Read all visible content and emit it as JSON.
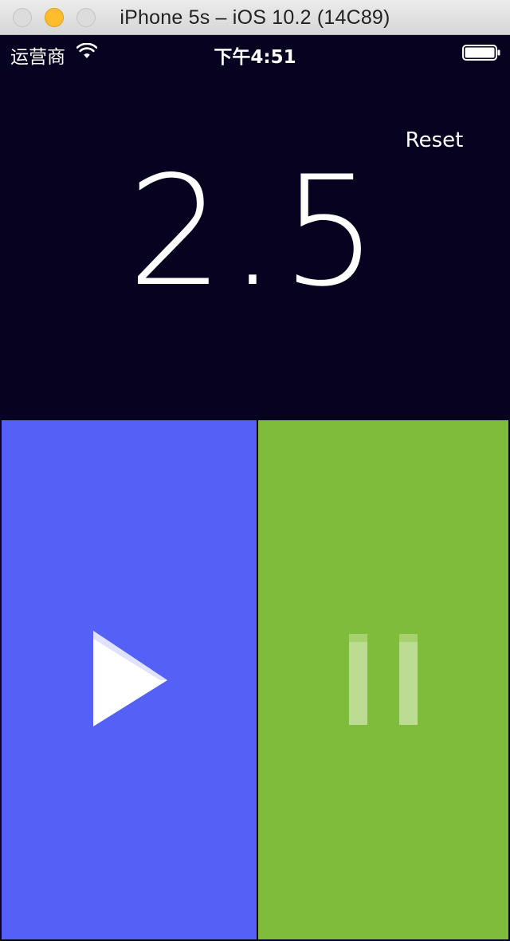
{
  "window": {
    "title": "iPhone 5s – iOS 10.2 (14C89)"
  },
  "status_bar": {
    "carrier": "运营商",
    "time": "下午4:51",
    "wifi_icon": "wifi-icon",
    "battery_icon": "battery-full-icon"
  },
  "display": {
    "reset_label": "Reset",
    "time_value": "2.5"
  },
  "controls": {
    "play_icon": "play-icon",
    "pause_icon": "pause-icon",
    "play_color": "#5560f4",
    "pause_color": "#80bc3b"
  },
  "colors": {
    "background": "#06021f",
    "text": "#ffffff"
  }
}
